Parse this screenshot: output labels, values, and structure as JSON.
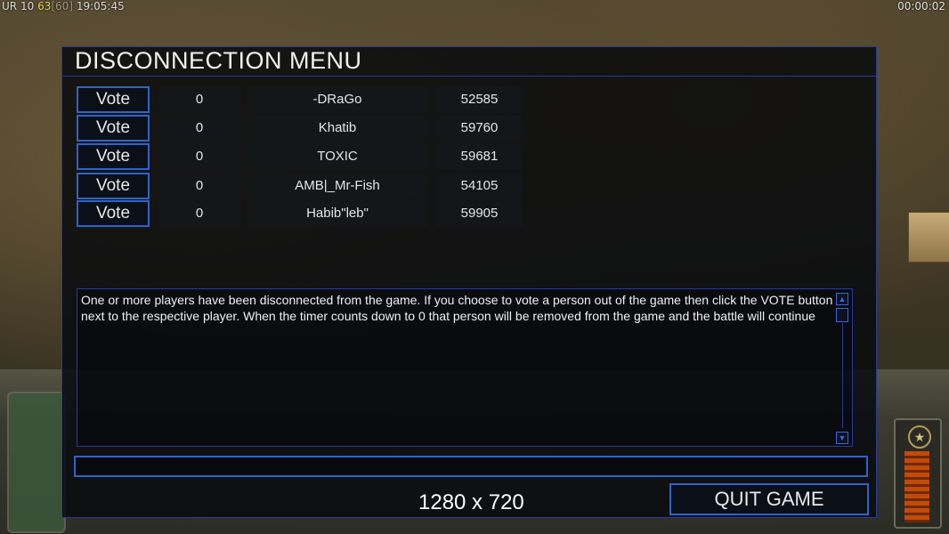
{
  "status_bar": {
    "left_prefix": "UR",
    "left_a": "10",
    "left_b": "63",
    "left_c": "[60]",
    "left_time": "19:05:45",
    "right_timer": "00:00:02"
  },
  "dialog": {
    "title": "DISCONNECTION MENU",
    "players": [
      {
        "vote_label": "Vote",
        "votes": "0",
        "name": "-DRaGo",
        "id": "52585"
      },
      {
        "vote_label": "Vote",
        "votes": "0",
        "name": "Khatib",
        "id": "59760"
      },
      {
        "vote_label": "Vote",
        "votes": "0",
        "name": "TOXIC",
        "id": "59681"
      },
      {
        "vote_label": "Vote",
        "votes": "0",
        "name": "AMB|_Mr-Fish",
        "id": "54105"
      },
      {
        "vote_label": "Vote",
        "votes": "0",
        "name": "Habib\"leb\"",
        "id": "59905"
      }
    ],
    "message": "One or more players have been disconnected from the game. If you choose to vote a person out of the game then click the VOTE button next to the respective player. When the timer counts down to 0 that person will be removed from the game and the battle will continue",
    "quit_label": "QUIT GAME"
  },
  "overlay_resolution": "1280 x 720",
  "colors": {
    "accent_border": "#2f63c8",
    "panel_bg": "#080a0e",
    "text": "#f0f0f0"
  }
}
